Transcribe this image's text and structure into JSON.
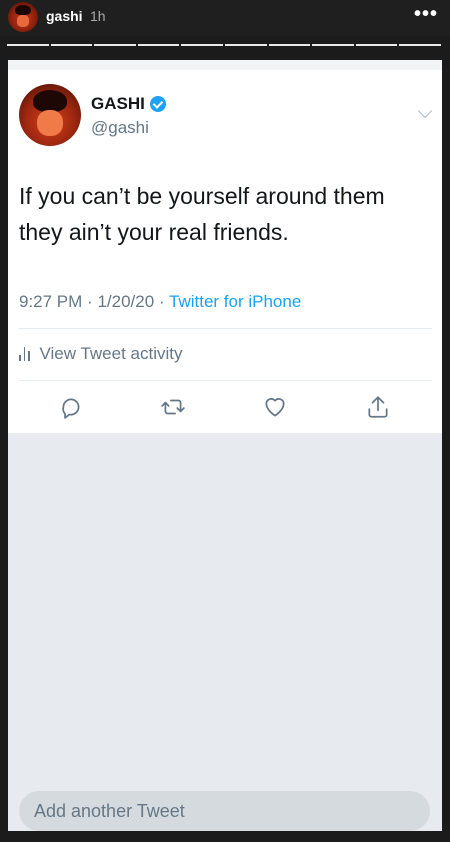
{
  "story": {
    "username": "gashi",
    "time": "1h",
    "menu_glyph": "•••",
    "progress_total_segments": 10,
    "progress_current_segment": 10
  },
  "tweet": {
    "display_name": "GASHI",
    "handle": "@gashi",
    "verified": true,
    "text": "If you can’t be yourself around them they ain’t your real friends.",
    "time": "9:27 PM",
    "date": "1/20/20",
    "source": "Twitter for iPhone",
    "separator": "·",
    "activity_label": "View Tweet activity",
    "actions": [
      "reply-icon",
      "retweet-icon",
      "like-icon",
      "share-icon"
    ]
  },
  "composer": {
    "placeholder": "Add another Tweet"
  },
  "colors": {
    "twitter_blue": "#1da1f2",
    "secondary_text": "#657786",
    "story_bg": "#1b1b1b"
  }
}
